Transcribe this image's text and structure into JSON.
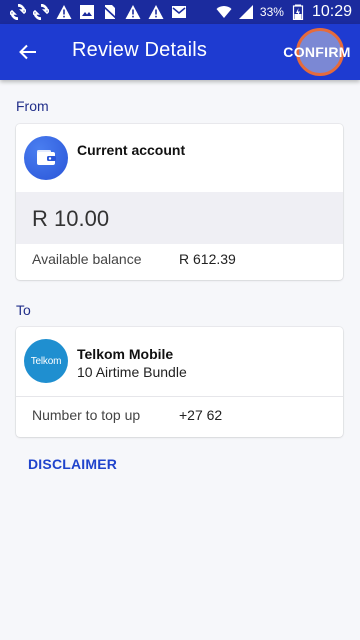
{
  "status_bar": {
    "icons": [
      "sync-icon",
      "sync-icon",
      "warning-icon",
      "image-icon",
      "no-sim-icon",
      "warning-icon",
      "warning-icon",
      "mail-icon",
      "wifi-icon",
      "signal-icon",
      "battery-icon"
    ],
    "battery": "33%",
    "time": "10:29"
  },
  "app_bar": {
    "title": "Review Details",
    "confirm_label": "CONFIRM",
    "back_icon": "arrow-left-icon"
  },
  "from": {
    "label": "From",
    "account_name": "Current account",
    "account_icon": "wallet-icon",
    "amount": "R 10.00",
    "balance_label": "Available balance",
    "balance_value": "R 612.39"
  },
  "to": {
    "label": "To",
    "logo_text": "Telkom",
    "biller_name": "Telkom Mobile",
    "product": "10 Airtime Bundle",
    "number_label": "Number to top up",
    "number_value": "+27 62"
  },
  "disclaimer_label": "DISCLAIMER",
  "colors": {
    "status_bar": "#1b2b9e",
    "app_bar": "#1e3bd1",
    "accent_link": "#2044cc",
    "telkom_blue": "#1f8fd0",
    "background": "#f6f7fa"
  }
}
